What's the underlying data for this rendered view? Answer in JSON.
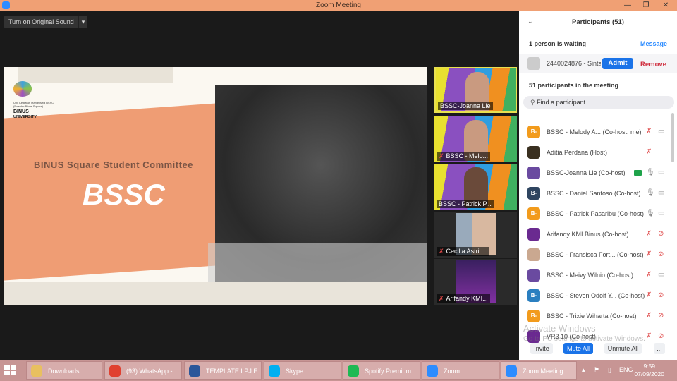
{
  "window": {
    "title": "Zoom Meeting",
    "min": "—",
    "max": "❐",
    "close": "✕"
  },
  "meeting": {
    "original_sound": "Turn on Original Sound",
    "dropdown": "▾"
  },
  "slide": {
    "logo_sub": "Unit Kegiatan Mahasiswa BSSC (Boarder Binus Square)",
    "logo_binus": "BINUS",
    "logo_university": "UNIVERSITY",
    "subtitle": "BINUS Square Student Committee",
    "title": "BSSC"
  },
  "thumbnails": [
    {
      "name": "BSSC-Joanna Lie",
      "muted": false,
      "active": true
    },
    {
      "name": "BSSC - Melo...",
      "muted": true
    },
    {
      "name": "BSSC - Patrick P...",
      "muted": false
    },
    {
      "name": "Cecilia Astri ...",
      "muted": true
    },
    {
      "name": "Arifandy KMI...",
      "muted": true
    }
  ],
  "panel": {
    "title": "Participants (51)",
    "waiting_label": "1 person is waiting",
    "message": "Message",
    "waiting_name": "2440024876 - Sinta",
    "admit": "Admit",
    "remove": "Remove",
    "in_meeting": "51 participants in the meeting",
    "search_placeholder": "Find a participant",
    "participants": [
      {
        "avatar": "B-",
        "color": "#f29b1c",
        "name": "BSSC - Melody A...  (Co-host, me)",
        "mic": "muted",
        "cam": "on"
      },
      {
        "avatar": "",
        "color": "#3a3020",
        "name": "Aditia Perdana (Host)",
        "mic": "muted",
        "cam": "none"
      },
      {
        "avatar": "",
        "color": "#6a4aa0",
        "name": "BSSC-Joanna Lie (Co-host)",
        "mic": "on",
        "cam": "on",
        "sharing": true
      },
      {
        "avatar": "B-",
        "color": "#2f4560",
        "name": "BSSC - Daniel Santoso (Co-host)",
        "mic": "on",
        "cam": "on"
      },
      {
        "avatar": "B-",
        "color": "#f29b1c",
        "name": "BSSC - Patrick Pasaribu (Co-host)",
        "mic": "on",
        "cam": "on"
      },
      {
        "avatar": "",
        "color": "#6a2a90",
        "name": "Arifandy KMI Binus (Co-host)",
        "mic": "muted",
        "cam": "off"
      },
      {
        "avatar": "",
        "color": "#caa890",
        "name": "BSSC - Fransisca Fort...  (Co-host)",
        "mic": "muted",
        "cam": "off"
      },
      {
        "avatar": "",
        "color": "#6a4aa0",
        "name": "BSSC - Meivy Wilnio (Co-host)",
        "mic": "muted",
        "cam": "on"
      },
      {
        "avatar": "B-",
        "color": "#2a7fc0",
        "name": "BSSC - Steven Odolf Y... (Co-host)",
        "mic": "muted",
        "cam": "off"
      },
      {
        "avatar": "B-",
        "color": "#f29b1c",
        "name": "BSSC - Trixie Wiharta (Co-host)",
        "mic": "muted",
        "cam": "off"
      },
      {
        "avatar": "",
        "color": "#6a2a90",
        "name": "VR3 10 (Co-host)",
        "mic": "muted",
        "cam": "off"
      }
    ],
    "watermark_title": "Activate Windows",
    "watermark_sub": "Go to PC settings to activate Windows.",
    "invite": "Invite",
    "mute_all": "Mute All",
    "unmute_all": "Unmute All",
    "more": "..."
  },
  "taskbar": {
    "items": [
      {
        "label": "Downloads",
        "color": "#e8c060"
      },
      {
        "label": "(93) WhatsApp - ...",
        "color": "#e04030"
      },
      {
        "label": "TEMPLATE LPJ E...",
        "color": "#2b579a"
      },
      {
        "label": "Skype",
        "color": "#00aff0"
      },
      {
        "label": "Spotify Premium",
        "color": "#1db954"
      },
      {
        "label": "Zoom",
        "color": "#2d8cff"
      },
      {
        "label": "Zoom Meeting",
        "color": "#2d8cff"
      }
    ],
    "lang": "ENG",
    "time": "9:59",
    "date": "07/09/2020"
  }
}
